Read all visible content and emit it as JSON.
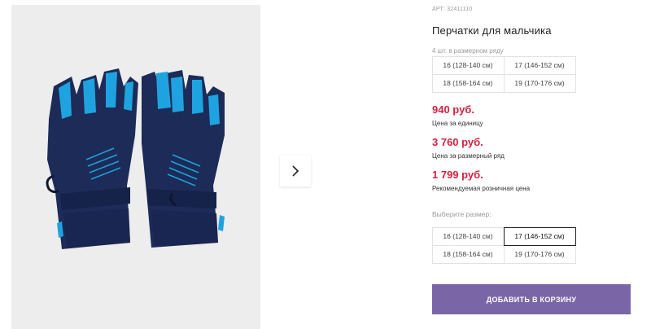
{
  "product": {
    "sku": "АРТ: 32411110",
    "title": "Перчатки для мальчика",
    "pack_note": "4 шт. в размерном ряду",
    "pack_sizes": [
      "16 (128-140 см)",
      "17 (146-152 см)",
      "18 (158-164 см)",
      "19 (170-176 см)"
    ]
  },
  "prices": [
    {
      "amount": "940 руб.",
      "note": "Цена за единицу"
    },
    {
      "amount": "3 760 руб.",
      "note": "Цена за размерный ряд"
    },
    {
      "amount": "1 799 руб.",
      "note": "Рекомендуемая розничная цена"
    }
  ],
  "size_select": {
    "label": "Выберите размер:",
    "options": [
      "16 (128-140 см)",
      "17 (146-152 см)",
      "18 (158-164 см)",
      "19 (170-176 см)"
    ],
    "selected": "17 (146-152 см)"
  },
  "actions": {
    "add_to_cart": "ДОБАВИТЬ В КОРЗИНУ"
  },
  "icons": {
    "next": "chevron-right-icon"
  },
  "colors": {
    "price": "#d6203e",
    "button": "#7a66a6",
    "glove_navy": "#1c2b57",
    "glove_accent": "#1ea3e0"
  }
}
